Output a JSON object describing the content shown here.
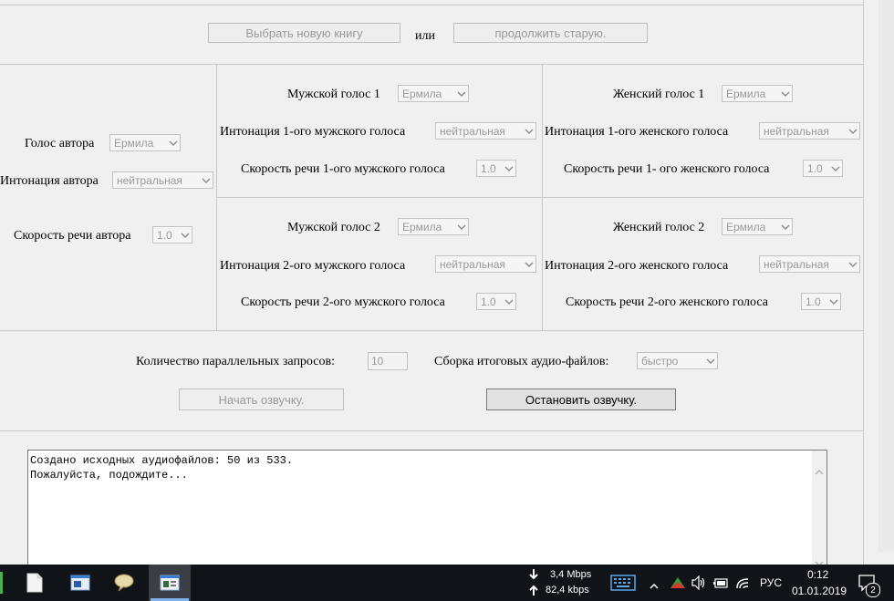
{
  "top": {
    "choose_new_book": "Выбрать новую книгу",
    "or_label": "или",
    "continue_old": "продолжить  старую."
  },
  "author": {
    "voice_label": "Голос автора",
    "voice_value": "Ермила",
    "intonation_label": "Интонация автора",
    "intonation_value": "нейтральная",
    "speed_label": "Скорость речи автора",
    "speed_value": "1.0"
  },
  "male1": {
    "voice_label": "Мужской голос 1",
    "voice_value": "Ермила",
    "intonation_label": "Интонация 1-ого мужского голоса",
    "intonation_value": "нейтральная",
    "speed_label": "Скорость речи 1-ого мужского голоса",
    "speed_value": "1.0"
  },
  "female1": {
    "voice_label": "Женский голос 1",
    "voice_value": "Ермила",
    "intonation_label": "Интонация 1-ого женского голоса",
    "intonation_value": "нейтральная",
    "speed_label": "Скорость речи 1- ого женского голоса",
    "speed_value": "1.0"
  },
  "male2": {
    "voice_label": "Мужской голос 2",
    "voice_value": "Ермила",
    "intonation_label": "Интонация 2-ого мужского голоса",
    "intonation_value": "нейтральная",
    "speed_label": "Скорость речи 2-ого мужского голоса",
    "speed_value": "1.0"
  },
  "female2": {
    "voice_label": "Женский голос 2",
    "voice_value": "Ермила",
    "intonation_label": "Интонация 2-ого женского голоса",
    "intonation_value": "нейтральная",
    "speed_label": "Скорость речи 2-ого женского голоса",
    "speed_value": "1.0"
  },
  "settings": {
    "parallel_label": "Количество параллельных запросов:",
    "parallel_value": "10",
    "assembly_label": "Сборка итоговых аудио-файлов:",
    "assembly_value": "быстро"
  },
  "actions": {
    "start_label": "Начать озвучку.",
    "stop_label": "Остановить озвучку."
  },
  "log": {
    "lines": [
      "Создано исходных аудиофайлов: 50 из 533.",
      "Пожалуйста, подождите..."
    ]
  },
  "taskbar": {
    "download_speed": "3,4 Mbps",
    "upload_speed": "82,4 kbps",
    "language": "РУС",
    "time": "0:12",
    "date": "01.01.2019",
    "notification_count": "2"
  },
  "colors": {
    "window_bg": "#f0f0f0",
    "taskbar_bg": "#101318",
    "disabled_text": "#9a9a9a"
  }
}
